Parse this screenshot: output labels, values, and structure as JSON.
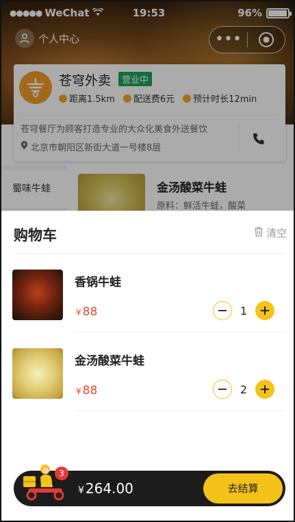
{
  "status_bar": {
    "carrier": "WeChat",
    "time": "19:53",
    "battery": "96%"
  },
  "header": {
    "user_center_label": "个人中心"
  },
  "store": {
    "name": "苍穹外卖",
    "status": "营业中",
    "distance": "距离1.5km",
    "delivery_fee": "配送费6元",
    "eta": "预计时长12min",
    "description": "苍穹餐厅为顾客打造专业的大众化美食外送餐饮",
    "address": "北京市朝阳区新街大道一号楼8层"
  },
  "menu": {
    "active_category": "蜀味牛蛙",
    "dish_name": "金汤酸菜牛蛙",
    "dish_desc": "原料：鲜活牛蛙，酸菜"
  },
  "cart": {
    "title": "购物车",
    "clear_label": "清空",
    "currency": "¥",
    "items": [
      {
        "name": "香锅牛蛙",
        "price": "88",
        "qty": "1"
      },
      {
        "name": "金汤酸菜牛蛙",
        "price": "88",
        "qty": "2"
      }
    ]
  },
  "checkout": {
    "currency": "¥",
    "total": "264.00",
    "badge_count": "3",
    "button_label": "去结算"
  },
  "colors": {
    "accent": "#f5c21a",
    "price": "#e64a2e",
    "open_badge": "#1aa35a",
    "bar": "#1c1c1c"
  }
}
